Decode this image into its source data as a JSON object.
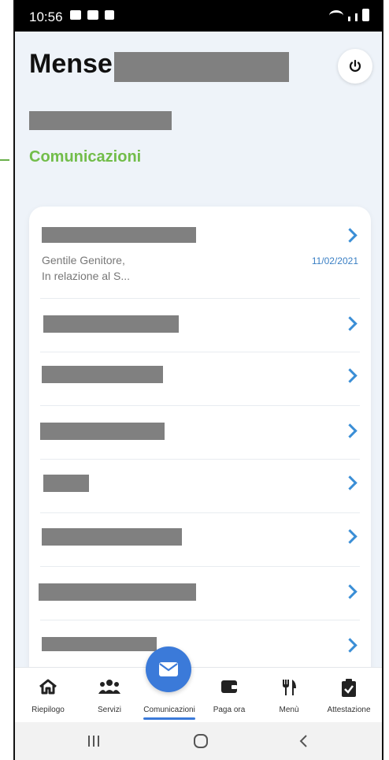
{
  "status_bar": {
    "time": "10:56"
  },
  "header": {
    "title": "Mense",
    "section_title": "Comunicazioni"
  },
  "messages": [
    {
      "preview": "Gentile Genitore,\nIn relazione al S...",
      "date": "11/02/2021"
    },
    {
      "preview": "",
      "date": ""
    },
    {
      "preview": "",
      "date": ""
    },
    {
      "preview": "",
      "date": ""
    },
    {
      "preview": "",
      "date": ""
    },
    {
      "preview": "",
      "date": ""
    },
    {
      "preview": "",
      "date": ""
    },
    {
      "preview": "",
      "date": ""
    }
  ],
  "bottom_nav": {
    "items": [
      {
        "label": "Riepilogo",
        "icon": "home-icon"
      },
      {
        "label": "Servizi",
        "icon": "users-icon"
      },
      {
        "label": "Comunicazioni",
        "icon": "envelope-icon"
      },
      {
        "label": "Paga ora",
        "icon": "wallet-icon"
      },
      {
        "label": "Menù",
        "icon": "fork-knife-icon"
      },
      {
        "label": "Attestazione",
        "icon": "clipboard-check-icon"
      }
    ],
    "active": "Comunicazioni"
  },
  "colors": {
    "accent_green": "#72bd4a",
    "accent_blue": "#3b7ad9",
    "background": "#eef3f9"
  }
}
